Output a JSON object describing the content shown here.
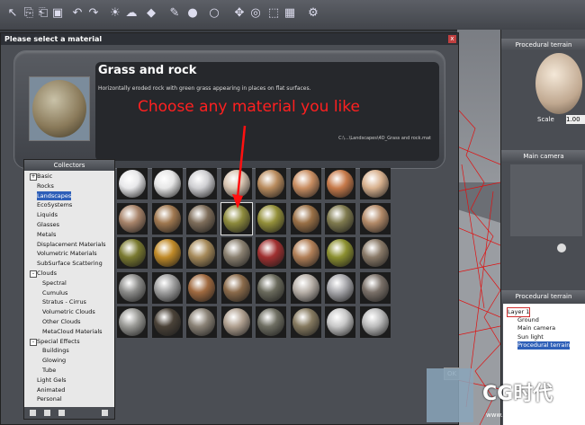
{
  "toolbar": {
    "icons": [
      "select-icon",
      "copy-icon",
      "paste-icon",
      "save-icon",
      "undo-icon",
      "redo-icon",
      "sky-icon",
      "cloud-icon",
      "object-icon",
      "render-icon",
      "color-icon",
      "zoom-icon",
      "pan-icon",
      "orbit-icon",
      "frame-icon",
      "grid-icon",
      "settings-icon"
    ]
  },
  "dialog": {
    "title": "Please select a material",
    "close_label": "x",
    "material": {
      "name": "Grass and rock",
      "description": "Horizontally eroded rock with green grass appearing in places on flat surfaces.",
      "path": "C:\\...\\Landscapes\\4D_Grass and rock.mat"
    },
    "hint": "Choose any material you like",
    "collectors": {
      "header": "Collectors",
      "items": [
        {
          "label": "Basic",
          "indent": 1,
          "expander": "+"
        },
        {
          "label": "Rocks",
          "indent": 1,
          "expander": ""
        },
        {
          "label": "Landscapes",
          "indent": 1,
          "expander": "",
          "selected": true
        },
        {
          "label": "EcoSystems",
          "indent": 1,
          "expander": ""
        },
        {
          "label": "Liquids",
          "indent": 1,
          "expander": ""
        },
        {
          "label": "Glasses",
          "indent": 1,
          "expander": ""
        },
        {
          "label": "Metals",
          "indent": 1,
          "expander": ""
        },
        {
          "label": "Displacement Materials",
          "indent": 1,
          "expander": ""
        },
        {
          "label": "Volumetric Materials",
          "indent": 1,
          "expander": ""
        },
        {
          "label": "SubSurface Scattering",
          "indent": 1,
          "expander": ""
        },
        {
          "label": "Clouds",
          "indent": 0,
          "expander": "-"
        },
        {
          "label": "Spectral",
          "indent": 2,
          "expander": ""
        },
        {
          "label": "Cumulus",
          "indent": 2,
          "expander": ""
        },
        {
          "label": "Stratus - Cirrus",
          "indent": 2,
          "expander": ""
        },
        {
          "label": "Volumetric Clouds",
          "indent": 2,
          "expander": ""
        },
        {
          "label": "Other Clouds",
          "indent": 2,
          "expander": ""
        },
        {
          "label": "MetaCloud Materials",
          "indent": 2,
          "expander": ""
        },
        {
          "label": "Special Effects",
          "indent": 0,
          "expander": "-"
        },
        {
          "label": "Buildings",
          "indent": 2,
          "expander": ""
        },
        {
          "label": "Glowing",
          "indent": 2,
          "expander": ""
        },
        {
          "label": "Tube",
          "indent": 2,
          "expander": ""
        },
        {
          "label": "Light Gels",
          "indent": 1,
          "expander": ""
        },
        {
          "label": "Animated",
          "indent": 1,
          "expander": ""
        },
        {
          "label": "Personal",
          "indent": 1,
          "expander": ""
        }
      ]
    },
    "ok_label": "OK",
    "grid": {
      "rows": [
        [
          "#e8e8ea",
          "#e6e6e6",
          "#cfcfd2",
          "#d8c4b0",
          "#b98c5e",
          "#c98e62",
          "#c77a4a",
          "#d8b18e"
        ],
        [
          "#a8846a",
          "#a07850",
          "#7e6d5a",
          "#8d8a3c",
          "#94903a",
          "#9a7046",
          "#7f7a4e",
          "#b38a68"
        ],
        [
          "#7a7a30",
          "#c08a28",
          "#a68a5a",
          "#8a8070",
          "#a03030",
          "#b28058",
          "#8c9030",
          "#8a7a68"
        ],
        [
          "#8c8c8a",
          "#a0a0a0",
          "#a06a40",
          "#8a6a4a",
          "#6a6a5c",
          "#b8b0a8",
          "#a8a8ac",
          "#7a7068"
        ],
        [
          "#9a9a96",
          "#4a4238",
          "#8a8276",
          "#b0a090",
          "#6e6e62",
          "#867a60",
          "#c8c8c8",
          "#bcbcbc"
        ]
      ],
      "selected": [
        1,
        3
      ]
    }
  },
  "right_panel": {
    "preview_header": "Procedural terrain",
    "scale_label": "Scale",
    "scale_value": "1.00",
    "camera_header": "Main camera",
    "scene_header": "Procedural terrain",
    "tree": [
      {
        "label": "Layer 1",
        "indent": 0,
        "highlight": "outline"
      },
      {
        "label": "Ground",
        "indent": 1,
        "highlight": ""
      },
      {
        "label": "Main camera",
        "indent": 1,
        "highlight": ""
      },
      {
        "label": "Sun light",
        "indent": 1,
        "highlight": ""
      },
      {
        "label": "Procedural terrain",
        "indent": 1,
        "highlight": "selected"
      }
    ]
  },
  "watermark": {
    "text": "CG时代",
    "url": "www.cgtime.com.cn"
  }
}
